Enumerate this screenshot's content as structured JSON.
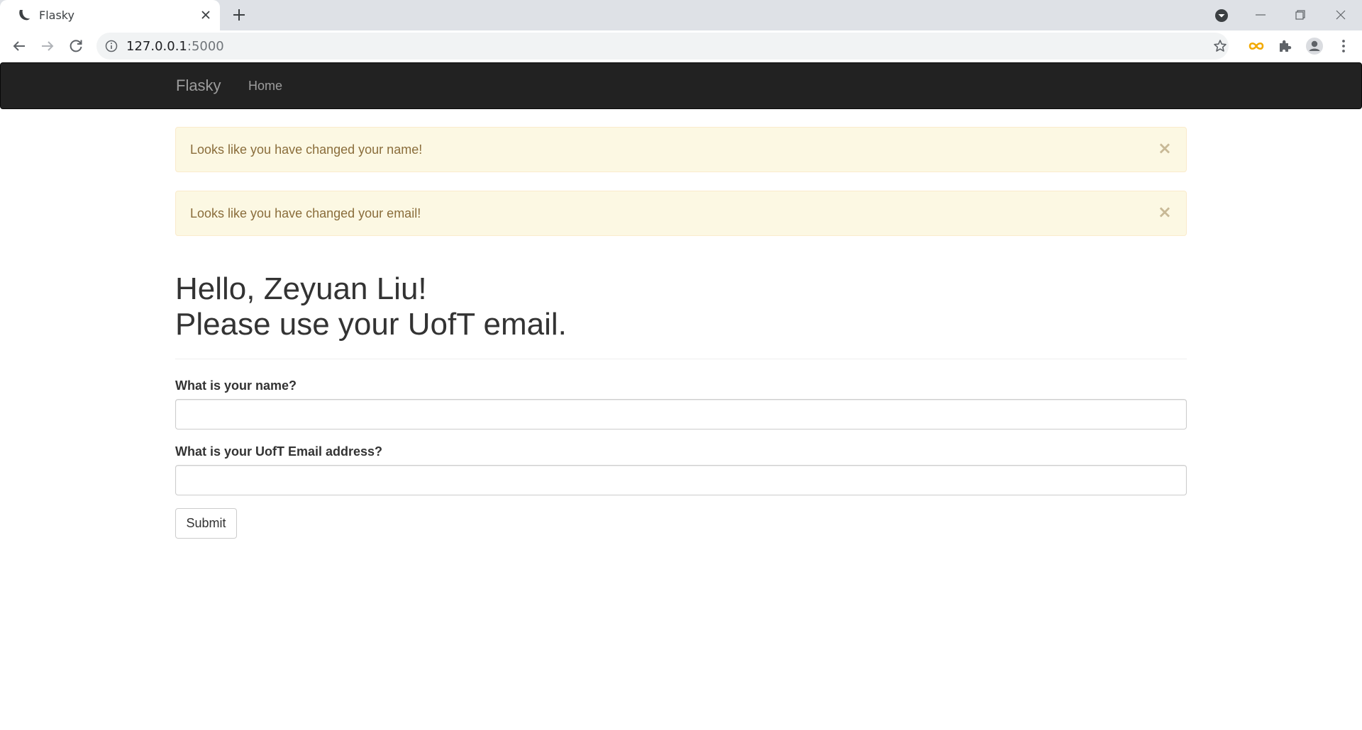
{
  "browser": {
    "tab_title": "Flasky",
    "url_host": "127.0.0.1",
    "url_port": ":5000"
  },
  "navbar": {
    "brand": "Flasky",
    "links": [
      {
        "label": "Home"
      }
    ]
  },
  "alerts": [
    {
      "text": "Looks like you have changed your name!",
      "close": "×"
    },
    {
      "text": "Looks like you have changed your email!",
      "close": "×"
    }
  ],
  "header": {
    "line1": "Hello, Zeyuan Liu!",
    "line2": "Please use your UofT email."
  },
  "form": {
    "name_label": "What is your name?",
    "name_value": "",
    "email_label": "What is your UofT Email address?",
    "email_value": "",
    "submit_label": "Submit"
  },
  "colors": {
    "navbar_bg": "#222222",
    "alert_bg": "#fcf8e3",
    "alert_text": "#8a6d3b",
    "extension_accent": "#f2a900"
  },
  "icons": [
    "flask-favicon-icon",
    "close-tab-icon",
    "new-tab-icon",
    "tab-search-icon",
    "minimize-icon",
    "restore-icon",
    "window-close-icon",
    "back-icon",
    "forward-icon",
    "reload-icon",
    "site-info-icon",
    "bookmark-star-icon",
    "extension-infinity-icon",
    "extensions-puzzle-icon",
    "profile-avatar-icon",
    "menu-kebab-icon"
  ]
}
